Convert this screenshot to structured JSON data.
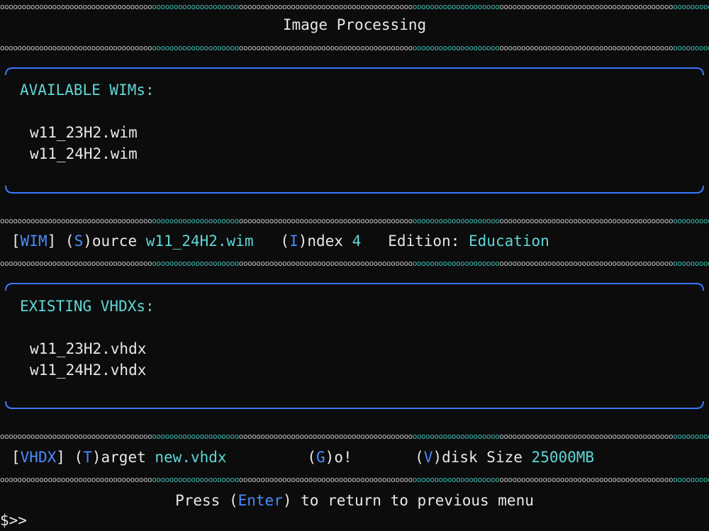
{
  "header": {
    "title": "Image Processing"
  },
  "wim_panel": {
    "heading": "AVAILABLE WIMs:",
    "items": [
      "w11_23H2.wim",
      "w11_24H2.wim"
    ]
  },
  "wim_status": {
    "tag_open": "[",
    "tag": "WIM",
    "tag_close": "]",
    "source_key": "S",
    "source_rest": "ource",
    "source_value": "w11_24H2.wim",
    "index_key": "I",
    "index_rest": "ndex",
    "index_value": "4",
    "edition_label": "Edition:",
    "edition_value": "Education"
  },
  "vhdx_panel": {
    "heading": "EXISTING VHDXs:",
    "items": [
      "w11_23H2.vhdx",
      "w11_24H2.vhdx"
    ]
  },
  "vhdx_status": {
    "tag_open": "[",
    "tag": "VHDX",
    "tag_close": "]",
    "target_key": "T",
    "target_rest": "arget",
    "target_value": "new.vhdx",
    "go_key": "G",
    "go_rest": "o!",
    "size_key": "V",
    "size_rest": "disk Size",
    "size_value": "25000MB"
  },
  "footer": {
    "press": "Press",
    "enter_key": "Enter",
    "rest": "to return to previous menu"
  },
  "prompt": "$>>",
  "colors": {
    "background": "#0c0c0c",
    "text": "#e8e8e8",
    "cyan": "#5fd7d7",
    "blue": "#4a8cff",
    "border": "#3b78ff"
  }
}
